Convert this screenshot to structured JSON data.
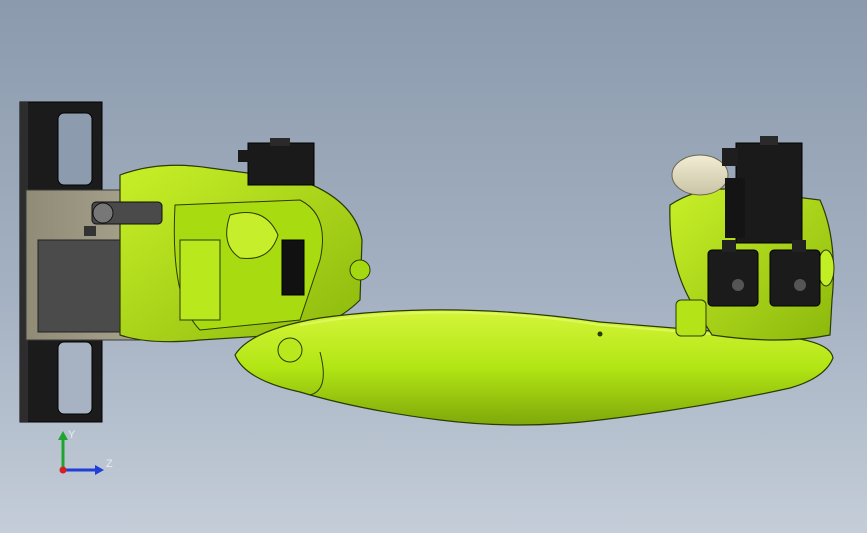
{
  "viewport": {
    "background_top": "#8b9aad",
    "background_bottom": "#c4cdd8"
  },
  "model": {
    "part_color": "#b5ea14",
    "motor_color": "#1a1a1a",
    "plate_color": "#9e9a85"
  },
  "triad": {
    "y_label": "Y",
    "z_label": "Z",
    "y_color": "#1fa52f",
    "z_color": "#1f3fd6",
    "x_color": "#d61f1f"
  }
}
